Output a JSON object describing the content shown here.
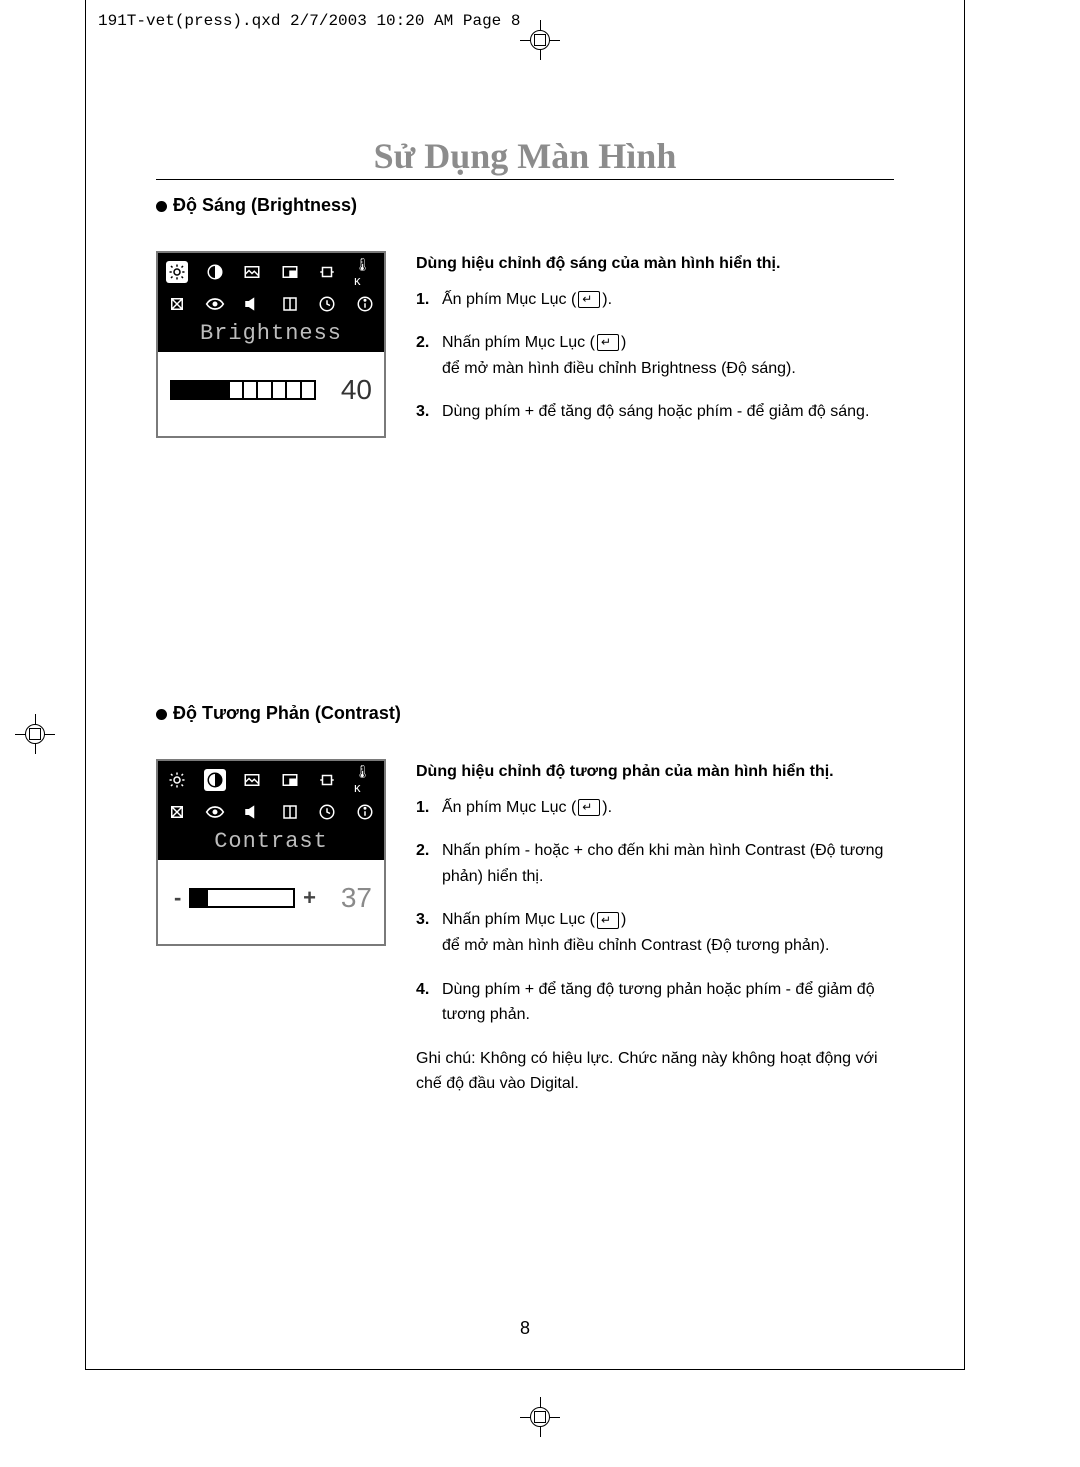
{
  "header_line": "191T-vet(press).qxd  2/7/2003  10:20 AM  Page 8",
  "title": "Sử Dụng Màn Hình",
  "page_number": "8",
  "brightness": {
    "heading": "Độ Sáng (Brightness)",
    "osd_label": "Brightness",
    "value": "40",
    "fill_pct": 40,
    "lead": "Dùng hiệu chỉnh độ sáng của màn hình hiển thị.",
    "steps": [
      "Ấn phím Mục Lục (",
      "Nhấn phím Mục Lục (",
      "Dùng phím + để tăng độ sáng hoặc phím - để giảm độ sáng."
    ],
    "step2_tail": "để mở màn hình điều chỉnh Brightness (Độ sáng)."
  },
  "contrast": {
    "heading": "Độ Tương Phản (Contrast)",
    "osd_label": "Contrast",
    "value": "37",
    "fill_pct": 16,
    "lead": "Dùng hiệu chỉnh độ tương phản của màn hình hiển thị.",
    "steps": [
      "Ấn phím Mục Lục (",
      "Nhấn phím - hoặc + cho đến khi màn hình Contrast (Độ tương phản) hiển thị.",
      "Nhấn phím Mục Lục (",
      "Dùng phím + để tăng độ tương phản hoặc phím - để giảm độ tương phản."
    ],
    "step3_tail": "để mở màn hình điều chỉnh Contrast (Độ tương phản).",
    "note": "Ghi chú: Không có hiệu lực. Chức năng này không hoạt động với chế độ đầu vào Digital."
  },
  "icons": {
    "brightness": "brightness-icon",
    "contrast": "contrast-icon",
    "image": "image-icon",
    "pip": "pip-icon",
    "aspect": "aspect-icon",
    "color": "color-k-icon",
    "geometry": "geometry-icon",
    "eye": "eye-icon",
    "volume": "volume-icon",
    "layout": "layout-icon",
    "clock": "clock-icon",
    "info": "info-icon"
  }
}
